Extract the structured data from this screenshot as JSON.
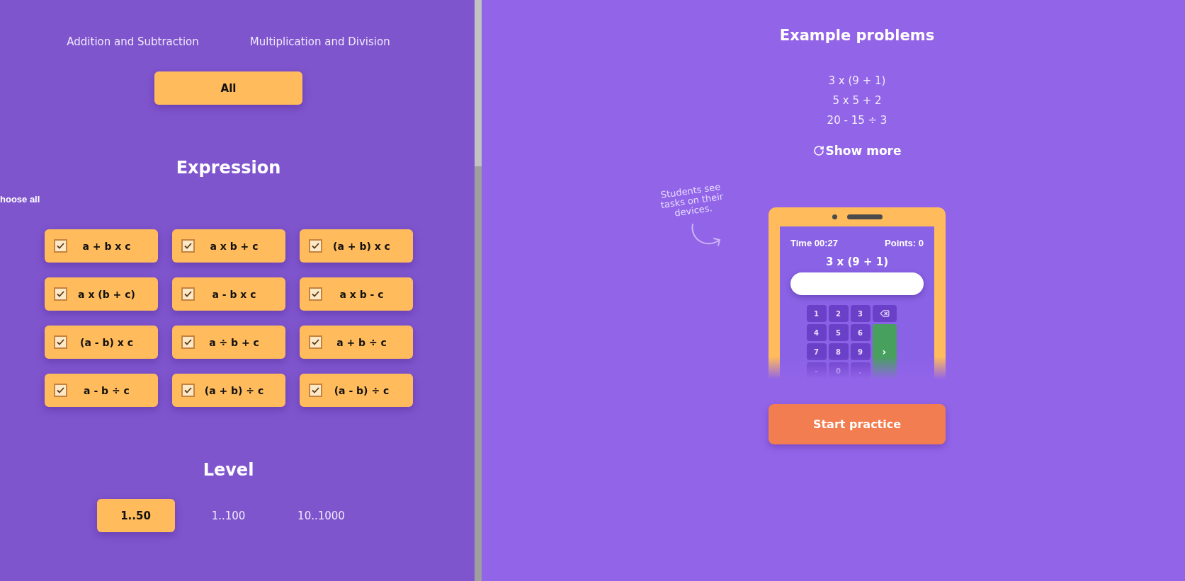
{
  "subtopic": {
    "options": [
      {
        "label": "Addition and Subtraction",
        "selected": false
      },
      {
        "label": "Multiplication and Division",
        "selected": false
      }
    ],
    "all": {
      "label": "All",
      "selected": true
    }
  },
  "expression": {
    "title": "Expression",
    "choose_all": "hoose all",
    "items": [
      {
        "label": "a + b x c",
        "checked": true
      },
      {
        "label": "a x b + c",
        "checked": true
      },
      {
        "label": "(a + b) x c",
        "checked": true
      },
      {
        "label": "a x (b + c)",
        "checked": true
      },
      {
        "label": "a - b x c",
        "checked": true
      },
      {
        "label": "a x b - c",
        "checked": true
      },
      {
        "label": "(a - b) x c",
        "checked": true
      },
      {
        "label": "a ÷ b + c",
        "checked": true
      },
      {
        "label": "a + b ÷ c",
        "checked": true
      },
      {
        "label": "a - b ÷ c",
        "checked": true
      },
      {
        "label": "(a + b) ÷ c",
        "checked": true
      },
      {
        "label": "(a - b) ÷ c",
        "checked": true
      }
    ]
  },
  "level": {
    "title": "Level",
    "options": [
      {
        "label": "1..50",
        "selected": true
      },
      {
        "label": "1..100",
        "selected": false
      },
      {
        "label": "10..1000",
        "selected": false
      }
    ]
  },
  "examples": {
    "title": "Example problems",
    "problems": [
      "3 x (9 + 1)",
      "5 x 5 + 2",
      "20 - 15 ÷ 3"
    ],
    "show_more": "Show more"
  },
  "note_lines": [
    "Students see",
    "tasks on their",
    "devices."
  ],
  "phone": {
    "time": "Time 00:27",
    "points": "Points: 0",
    "problem": "3 x (9 + 1)",
    "keys": [
      {
        "kind": "digit",
        "label": "1"
      },
      {
        "kind": "digit",
        "label": "2"
      },
      {
        "kind": "digit",
        "label": "3"
      },
      {
        "kind": "backspace"
      },
      {
        "kind": "digit",
        "label": "4"
      },
      {
        "kind": "digit",
        "label": "5"
      },
      {
        "kind": "digit",
        "label": "6"
      },
      {
        "kind": "digit",
        "label": "7"
      },
      {
        "kind": "digit",
        "label": "8"
      },
      {
        "kind": "digit",
        "label": "9"
      },
      {
        "kind": "enter",
        "label": "›"
      },
      {
        "kind": "digit",
        "label": "-"
      },
      {
        "kind": "digit",
        "label": "0"
      },
      {
        "kind": "digit",
        "label": "."
      }
    ]
  },
  "start_button": "Start practice"
}
